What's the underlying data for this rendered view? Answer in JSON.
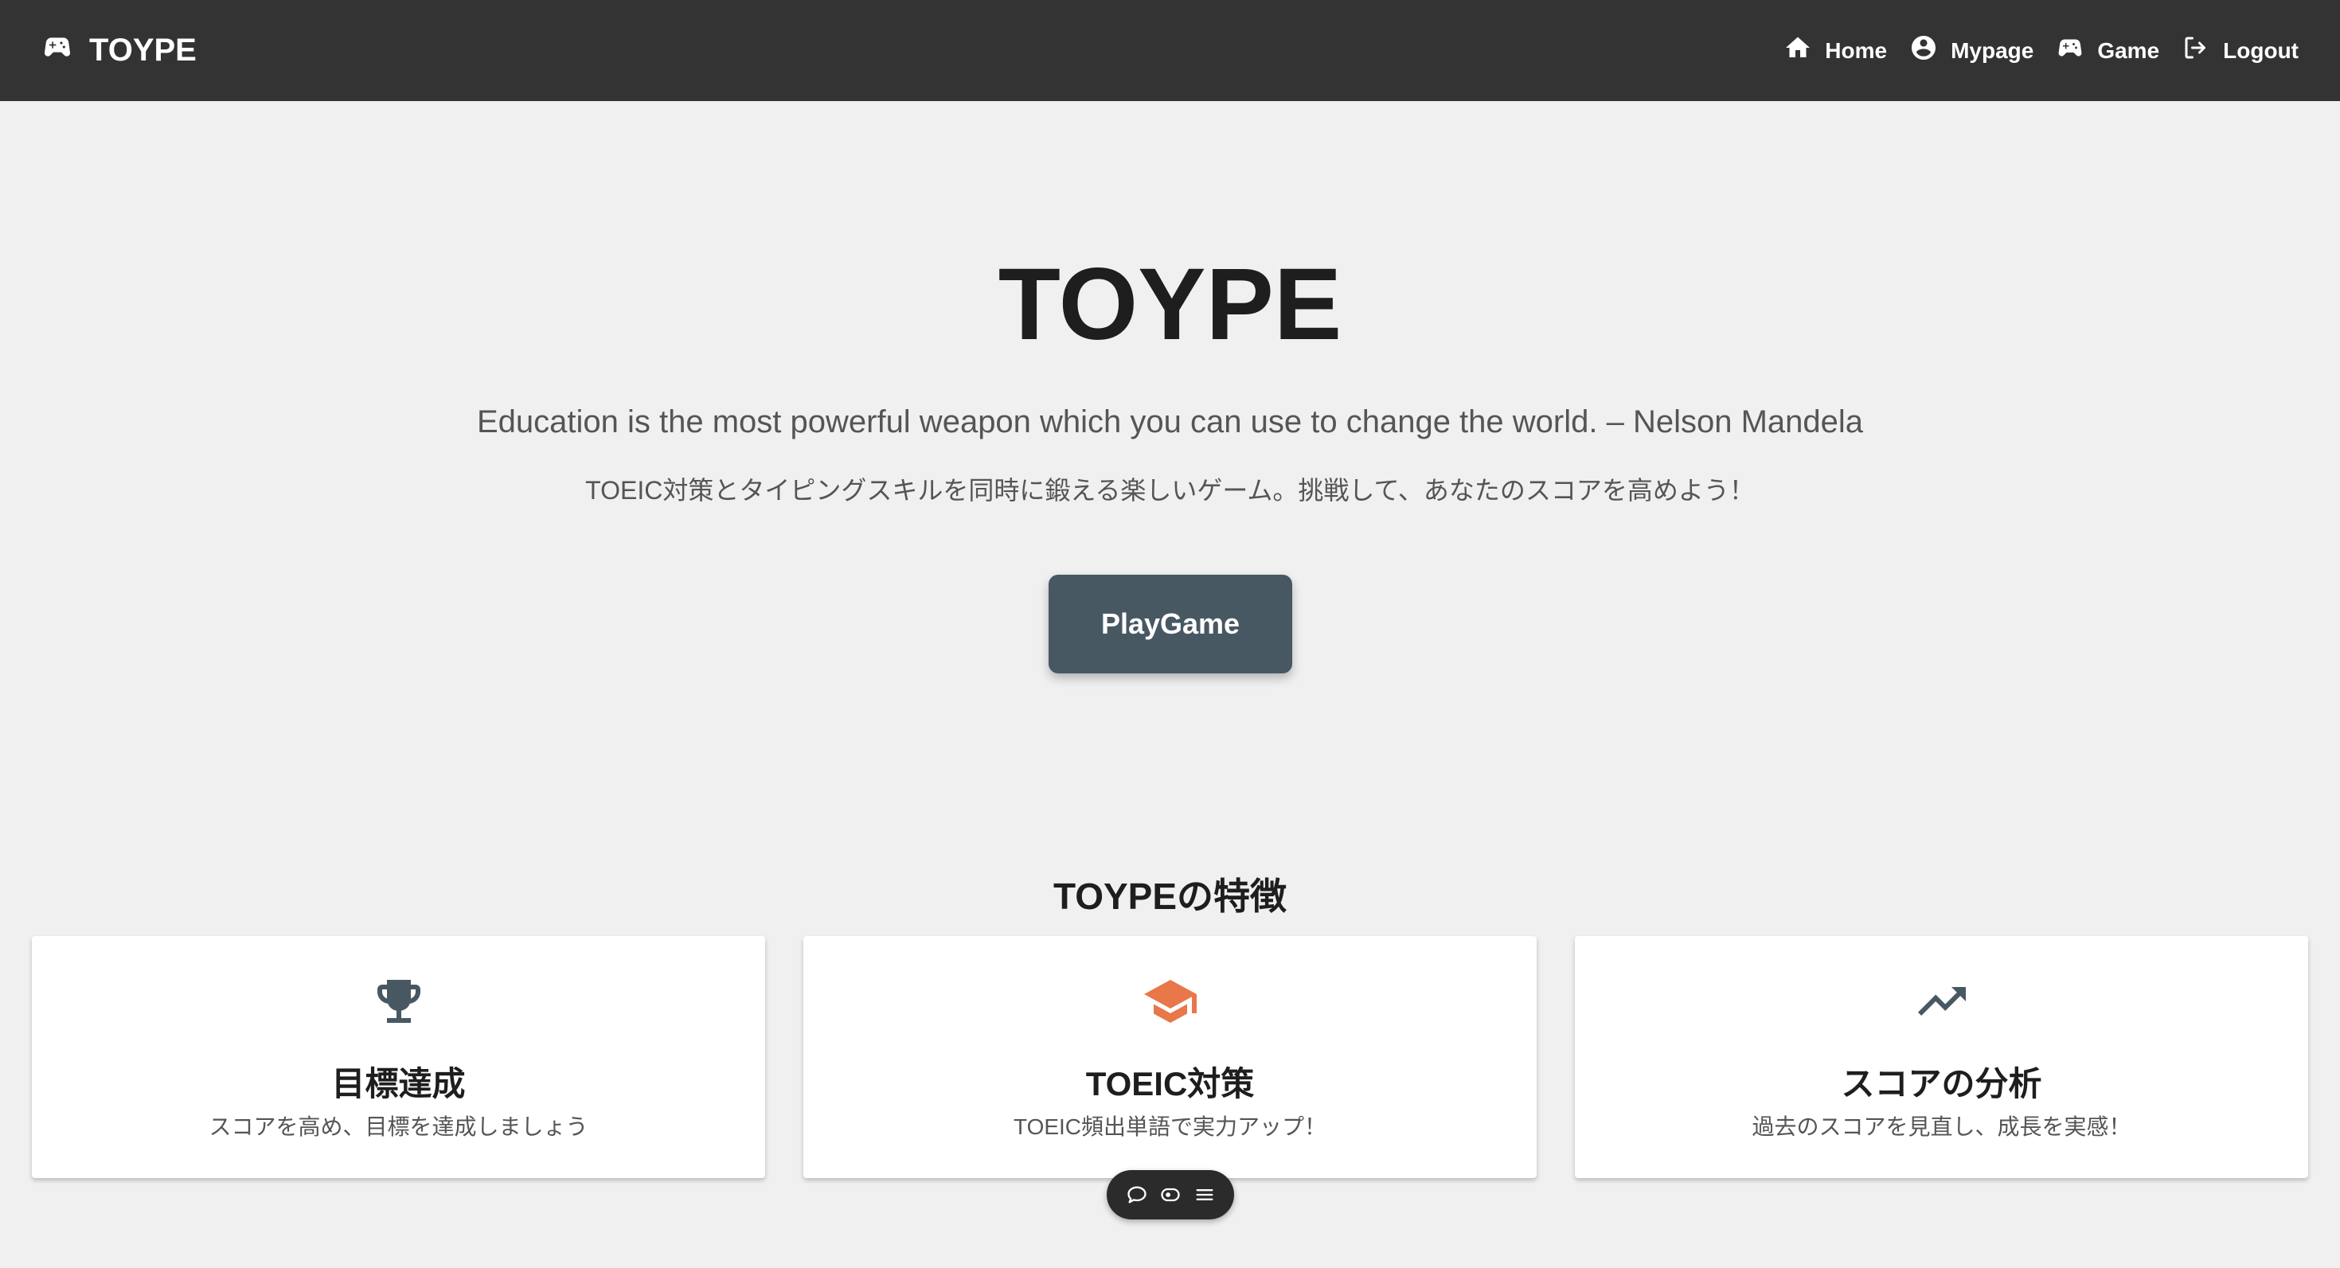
{
  "navbar": {
    "brand": "TOYPE",
    "links": [
      {
        "label": "Home",
        "icon": "home-icon"
      },
      {
        "label": "Mypage",
        "icon": "account-circle-icon"
      },
      {
        "label": "Game",
        "icon": "gamepad-icon"
      },
      {
        "label": "Logout",
        "icon": "logout-icon"
      }
    ]
  },
  "hero": {
    "title": "TOYPE",
    "quote": "Education is the most powerful weapon which you can use to change the world. – Nelson Mandela",
    "description": "TOEIC対策とタイピングスキルを同時に鍛える楽しいゲーム。挑戦して、あなたのスコアを高めよう！",
    "play_button": "PlayGame"
  },
  "features": {
    "title": "TOYPEの特徴",
    "cards": [
      {
        "icon": "trophy-icon",
        "icon_color": "#485863",
        "title": "目標達成",
        "description": "スコアを高め、目標を達成しましょう"
      },
      {
        "icon": "graduation-cap-icon",
        "icon_color": "#e8774a",
        "title": "TOEIC対策",
        "description": "TOEIC頻出単語で実力アップ！"
      },
      {
        "icon": "trending-up-icon",
        "icon_color": "#485863",
        "title": "スコアの分析",
        "description": "過去のスコアを見直し、成長を実感！"
      }
    ]
  },
  "floating_toolbar": {
    "buttons": [
      "comment-icon",
      "toggle-icon",
      "menu-icon"
    ]
  },
  "colors": {
    "navbar_bg": "#333333",
    "page_bg": "#f0f0f0",
    "primary_button": "#485863",
    "accent": "#e8774a"
  }
}
